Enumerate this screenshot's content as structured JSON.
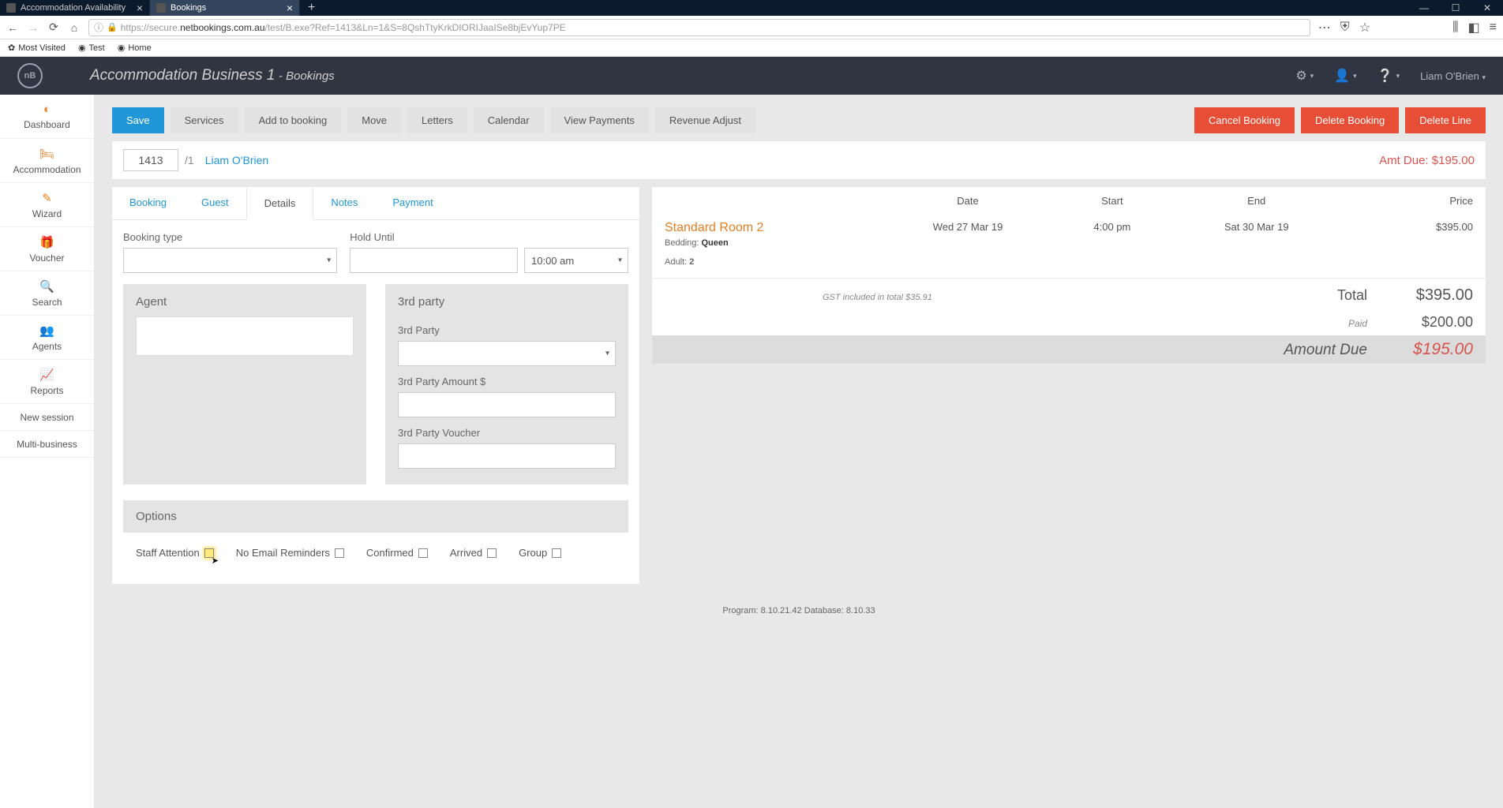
{
  "browser": {
    "tabs": [
      {
        "label": "Accommodation Availability",
        "active": false
      },
      {
        "label": "Bookings",
        "active": true
      }
    ],
    "url_prefix": "https://secure.",
    "url_domain": "netbookings.com.au",
    "url_path": "/test/B.exe?Ref=1413&Ln=1&S=8QshTtyKrkDIORIJaaISe8bjEvYup7PE",
    "bookmarks": [
      "Most Visited",
      "Test",
      "Home"
    ]
  },
  "header": {
    "business": "Accommodation Business 1",
    "page": "Bookings",
    "user": "Liam O'Brien"
  },
  "sidebar": {
    "items": [
      {
        "label": "Dashboard",
        "icon": "◐"
      },
      {
        "label": "Accommodation",
        "icon": "🛏"
      },
      {
        "label": "Wizard",
        "icon": "✎"
      },
      {
        "label": "Voucher",
        "icon": "🎁"
      },
      {
        "label": "Search",
        "icon": "🔍"
      },
      {
        "label": "Agents",
        "icon": "👥"
      },
      {
        "label": "Reports",
        "icon": "📈"
      }
    ],
    "simple_items": [
      "New session",
      "Multi-business"
    ]
  },
  "actions": {
    "primary": "Save",
    "buttons": [
      "Services",
      "Add to booking",
      "Move",
      "Letters",
      "Calendar",
      "View Payments",
      "Revenue Adjust"
    ],
    "danger": [
      "Cancel Booking",
      "Delete Booking",
      "Delete Line"
    ]
  },
  "ref": {
    "id": "1413",
    "line": "/1",
    "guest": "Liam O'Brien",
    "amt_due_label": "Amt Due: $195.00"
  },
  "tabs": [
    "Booking",
    "Guest",
    "Details",
    "Notes",
    "Payment"
  ],
  "active_tab": "Details",
  "details": {
    "booking_type_label": "Booking type",
    "booking_type_value": "",
    "hold_until_label": "Hold Until",
    "hold_until_date": "",
    "hold_until_time": "10:00 am",
    "agent_title": "Agent",
    "thirdparty_title": "3rd party",
    "tp_party_label": "3rd Party",
    "tp_party_value": "",
    "tp_amount_label": "3rd Party Amount $",
    "tp_amount_value": "",
    "tp_voucher_label": "3rd Party Voucher",
    "tp_voucher_value": "",
    "options_title": "Options",
    "options": [
      {
        "label": "Staff Attention",
        "checked": false,
        "highlighted": true
      },
      {
        "label": "No Email Reminders",
        "checked": false
      },
      {
        "label": "Confirmed",
        "checked": false
      },
      {
        "label": "Arrived",
        "checked": false
      },
      {
        "label": "Group",
        "checked": false
      }
    ]
  },
  "summary": {
    "headers": {
      "date": "Date",
      "start": "Start",
      "end": "End",
      "price": "Price"
    },
    "room": {
      "name": "Standard Room 2",
      "bedding_label": "Bedding:",
      "bedding_value": "Queen",
      "date": "Wed 27 Mar 19",
      "start": "4:00 pm",
      "end": "Sat 30 Mar 19",
      "price": "$395.00",
      "adult_label": "Adult:",
      "adult_value": "2"
    },
    "gst_note": "GST included in total $35.91",
    "total_label": "Total",
    "total_value": "$395.00",
    "paid_label": "Paid",
    "paid_value": "$200.00",
    "due_label": "Amount Due",
    "due_value": "$195.00"
  },
  "footer": "Program: 8.10.21.42 Database: 8.10.33"
}
